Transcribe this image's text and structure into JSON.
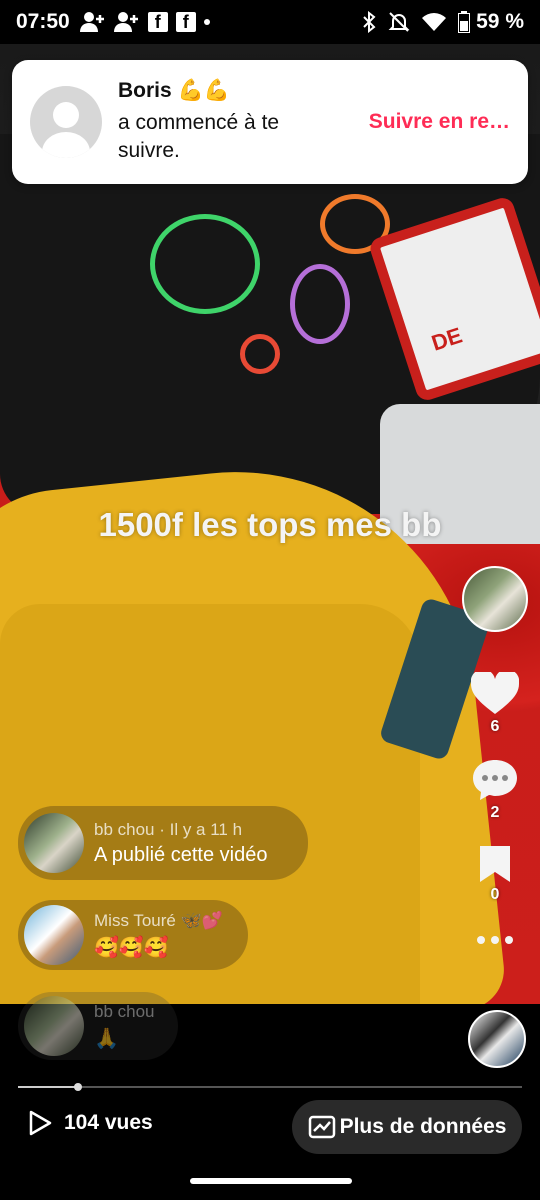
{
  "status_bar": {
    "time": "07:50",
    "battery_percent": "59 %"
  },
  "notification": {
    "name": "Boris 💪💪",
    "message": "a commencé à te suivre.",
    "action_label": "Suivre en re…"
  },
  "video": {
    "caption": "1500f les tops mes bb"
  },
  "rail": {
    "likes": "6",
    "comments": "2",
    "saves": "0"
  },
  "comments": [
    {
      "meta": "bb chou · Il y a 11 h",
      "text": "A publié cette vidéo"
    },
    {
      "meta": "Miss Touré 🦋💕",
      "text": "🥰🥰🥰"
    },
    {
      "meta": "bb chou",
      "text": "🙏"
    }
  ],
  "playback": {
    "progress_fraction": 0.12
  },
  "footer": {
    "views_label": "104 vues",
    "more_data_label": "Plus de données"
  },
  "colors": {
    "accent": "#fe2c55",
    "notification_bg": "#ffffff"
  }
}
